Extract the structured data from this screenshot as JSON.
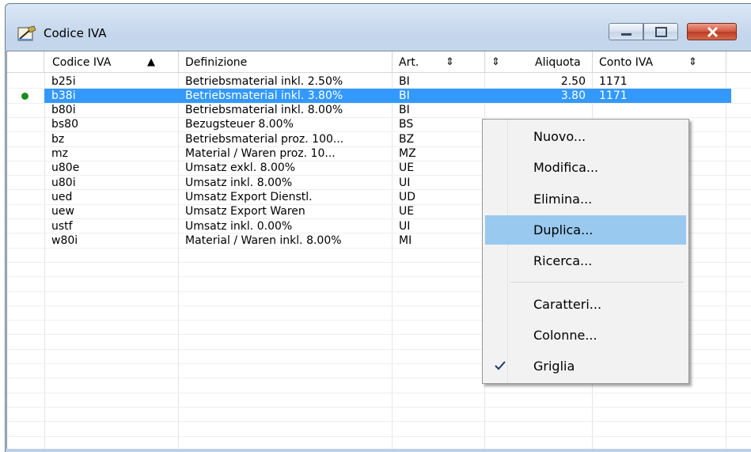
{
  "window": {
    "title": "Codice IVA"
  },
  "columns": [
    {
      "label": "Codice IVA",
      "sort": "▲"
    },
    {
      "label": "Definizione"
    },
    {
      "label": "Art.",
      "sort": "⇕"
    },
    {
      "label": "Aliquota",
      "sort": "⇕"
    },
    {
      "label": "Conto IVA",
      "sort": "⇕"
    }
  ],
  "rows": [
    {
      "code": "b25i",
      "def": "Betriebsmaterial inkl. 2.50%",
      "art": "BI",
      "rate": "2.50",
      "account": "1171"
    },
    {
      "code": "b38i",
      "def": "Betriebsmaterial inkl. 3.80%",
      "art": "BI",
      "rate": "3.80",
      "account": "1171",
      "selected": true
    },
    {
      "code": "b80i",
      "def": "Betriebsmaterial inkl. 8.00%",
      "art": "BI",
      "rate": "",
      "account": ""
    },
    {
      "code": "bs80",
      "def": "Bezugsteuer 8.00%",
      "art": "BS",
      "rate": "",
      "account": ""
    },
    {
      "code": "bz",
      "def": "Betriebsmaterial proz. 100...",
      "art": "BZ",
      "rate": "",
      "account": ""
    },
    {
      "code": "mz",
      "def": "Material / Waren proz. 10...",
      "art": "MZ",
      "rate": "",
      "account": ""
    },
    {
      "code": "u80e",
      "def": "Umsatz exkl. 8.00%",
      "art": "UE",
      "rate": "",
      "account": ""
    },
    {
      "code": "u80i",
      "def": "Umsatz inkl. 8.00%",
      "art": "UI",
      "rate": "",
      "account": ""
    },
    {
      "code": "ued",
      "def": "Umsatz Export Dienstl.",
      "art": "UD",
      "rate": "",
      "account": ""
    },
    {
      "code": "uew",
      "def": "Umsatz Export Waren",
      "art": "UE",
      "rate": "",
      "account": ""
    },
    {
      "code": "ustf",
      "def": "Umsatz inkl. 0.00%",
      "art": "UI",
      "rate": "",
      "account": ""
    },
    {
      "code": "w80i",
      "def": "Material / Waren inkl. 8.00%",
      "art": "MI",
      "rate": "",
      "account": ""
    }
  ],
  "context_menu": {
    "items": [
      {
        "label": "Nuovo..."
      },
      {
        "label": "Modifica..."
      },
      {
        "label": "Elimina..."
      },
      {
        "label": "Duplica...",
        "hover": true
      },
      {
        "label": "Ricerca..."
      },
      {
        "label": "Caratteri..."
      },
      {
        "label": "Colonne..."
      },
      {
        "label": "Griglia",
        "checked": true
      }
    ]
  },
  "colors": {
    "selection": "#3399ff",
    "menu_hover": "#99c9ef",
    "status_dot": "#1c8c1c"
  }
}
